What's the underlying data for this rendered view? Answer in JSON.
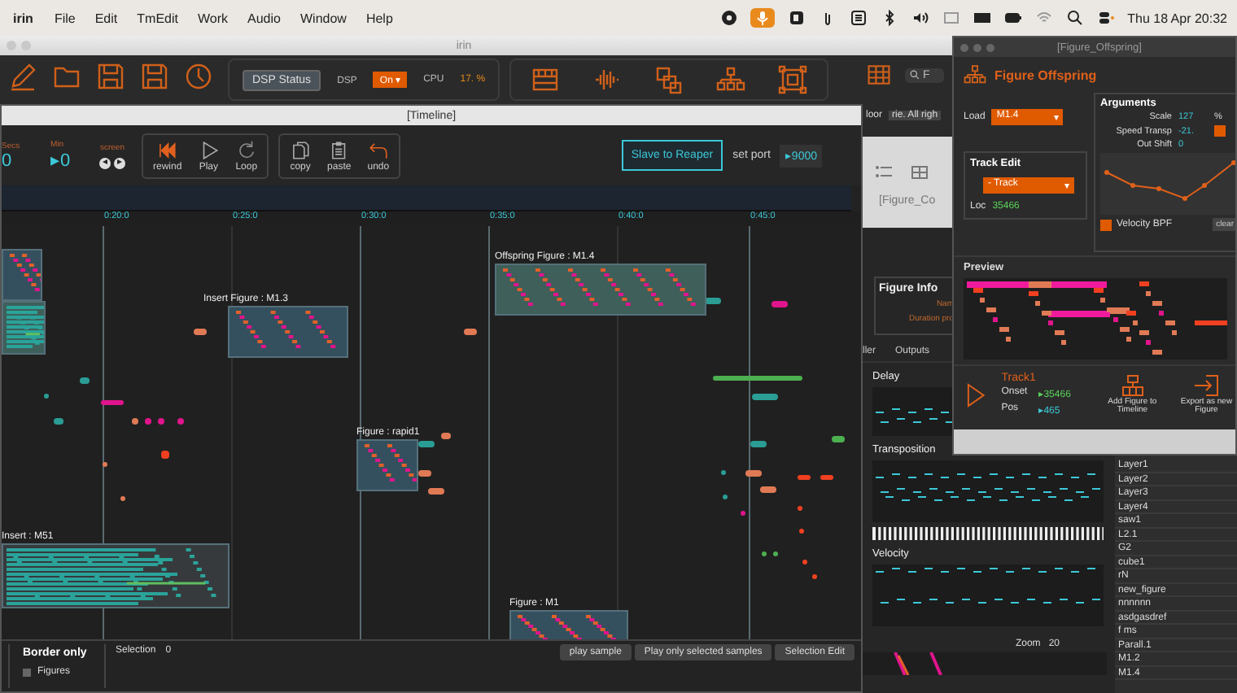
{
  "menubar": {
    "app": "irin",
    "menus": [
      "File",
      "Edit",
      "TmEdit",
      "Work",
      "Audio",
      "Window",
      "Help"
    ],
    "mic_active": true,
    "clock": "Thu 18 Apr  20:32"
  },
  "main_window": {
    "title": "irin",
    "dsp_button": "DSP Status",
    "dsp_label": "DSP",
    "dsp_value": "On",
    "caret": "▾",
    "cpu_label": "CPU",
    "cpu_value": "17. %",
    "search": {
      "placeholder": "F"
    },
    "clipped_texts": [
      "loor",
      "rie. All righ"
    ]
  },
  "timeline": {
    "title": "[Timeline]",
    "counters": [
      {
        "label": "Secs",
        "value": "0"
      },
      {
        "label": "Min",
        "value": "▸0"
      }
    ],
    "screen_label": "screen",
    "screen_arrows": [
      "◂",
      "▸"
    ],
    "transport": [
      {
        "kind": "rewind",
        "label": "rewind"
      },
      {
        "kind": "play",
        "label": "Play"
      },
      {
        "kind": "loop",
        "label": "Loop"
      }
    ],
    "edit": [
      {
        "kind": "copy",
        "label": "copy"
      },
      {
        "kind": "paste",
        "label": "paste"
      },
      {
        "kind": "undo",
        "label": "undo"
      }
    ],
    "slave": {
      "label": "Slave to Reaper",
      "on": true
    },
    "port_label": "set port",
    "port_value": "▸9000",
    "ruler": [
      "0:20:0",
      "0:25:0",
      "0:30:0",
      "0:35:0",
      "0:40:0",
      "0:45:0"
    ],
    "figures": [
      {
        "label": "Offspring Figure : M1.4",
        "color": "#3e5f5a"
      },
      {
        "label": "Insert Figure : M1.3",
        "color": "#34505e"
      },
      {
        "label": "Figure : rapid1",
        "color": "#34505e"
      },
      {
        "label": "Insert : M51",
        "color": "#363a3c"
      },
      {
        "label": "Figure : M1",
        "color": "#34505e"
      }
    ],
    "border_only": "Border only",
    "layers": [
      {
        "label": "Figures",
        "checked": false
      }
    ],
    "selection_label": "Selection",
    "selection_value": "0",
    "buttons": [
      "play sample",
      "Play only selected samples",
      "Selection Edit"
    ]
  },
  "figure_window": {
    "tab": "[Figure_Co",
    "info_title": "Figure Info",
    "info_fields": [
      "Nam",
      "Duration pro"
    ],
    "tabs": [
      {
        "label": "ller",
        "selected": false
      },
      {
        "label": "Outputs",
        "selected": false
      }
    ],
    "sections": [
      "Delay",
      "Transposition",
      "Velocity"
    ],
    "zoom_label": "Zoom",
    "zoom_value": "20",
    "layers": [
      "Layer1",
      "Layer2",
      "Layer3",
      "Layer4",
      "saw1",
      "L2.1",
      "G2",
      "cube1",
      "rN",
      "new_figure",
      "nnnnnn",
      "asdgasdref",
      "f ms",
      "Parall.1",
      "M1.2",
      "M1.4"
    ]
  },
  "offspring": {
    "title": "[Figure_Offspring]",
    "heading": "Figure Offspring",
    "load_label": "Load",
    "load_value": "M1.4",
    "load_caret": "▾",
    "arguments_title": "Arguments",
    "arguments": [
      {
        "label": "Scale",
        "value": "127",
        "unit": "%"
      },
      {
        "label": "Speed Transp",
        "value": "-21.",
        "checked": true
      },
      {
        "label": "Out Shift",
        "value": "0"
      }
    ],
    "velocity_bpf": {
      "label": "Velocity BPF",
      "checked": true
    },
    "clear_button": "clear",
    "track_edit_title": "Track Edit",
    "track_value": "- Track",
    "track_caret": "▾",
    "loc_label": "Loc",
    "loc_value": "35466",
    "preview_title": "Preview",
    "track_name": "Track1",
    "onset_label": "Onset",
    "onset_value": "▸35466",
    "pos_label": "Pos",
    "pos_value": "▸465",
    "add_button": "Add Figure to Timeline",
    "export_button": "Export as new Figure"
  }
}
